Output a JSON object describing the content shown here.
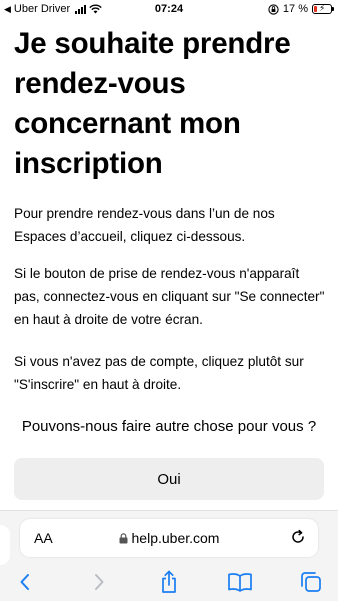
{
  "status_bar": {
    "back_label": "◀",
    "carrier": "Uber Driver",
    "time": "07:24",
    "battery_percent": "17 %",
    "battery_level": 0.17,
    "battery_color": "#e0301e"
  },
  "page": {
    "title": "Je souhaite prendre rendez-vous concernant mon inscription",
    "paragraph1": "Pour prendre rendez-vous dans l’un de nos Espaces d’accueil, cliquez ci-dessous.",
    "paragraph2": "Si le bouton de prise de rendez-vous n'apparaît pas, connectez-vous en cliquant sur \"Se connecter\" en haut à droite de votre écran.",
    "paragraph3": "Si vous n'avez pas de compte, cliquez plutôt sur \"S'inscrire\" en haut à droite.",
    "question": "Pouvons-nous faire autre chose pour vous ?",
    "yes_button": "Oui"
  },
  "browser": {
    "text_size_label": "AA",
    "url": "help.uber.com",
    "accent_color": "#1a7ef2",
    "icons": [
      "lock-icon",
      "reload-icon",
      "back-icon",
      "forward-icon",
      "share-icon",
      "bookmarks-icon",
      "tabs-icon"
    ]
  }
}
